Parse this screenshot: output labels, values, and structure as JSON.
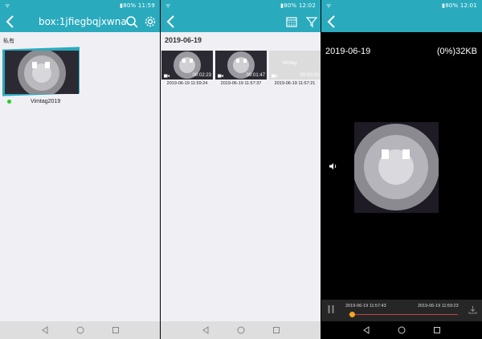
{
  "panel1": {
    "status": {
      "signal": "ᯤ",
      "battery": "▮80%",
      "time": "11:59"
    },
    "title": "box:1jfiegbqjxwna",
    "section_label": "私有",
    "device": {
      "name": "Vimtag2019",
      "online": true
    }
  },
  "panel2": {
    "status": {
      "signal": "ᯤ",
      "battery": "▮80%",
      "time": "12:02"
    },
    "date_header": "2019-06-19",
    "clips": [
      {
        "duration": "00:02:23",
        "timestamp": "2019-06-19 11:59:24"
      },
      {
        "duration": "00:01:47",
        "timestamp": "2019-06-19 11:57:37"
      },
      {
        "duration": "00:00:00",
        "timestamp": "2019-06-19 11:57:21",
        "brand": "Vimtag"
      }
    ]
  },
  "panel3": {
    "status": {
      "signal": "ᯤ",
      "battery": "▮80%",
      "time": "12:01"
    },
    "date": "2019-06-19",
    "size": "(0%)32KB",
    "start_time": "2019-06-19 11:57:43",
    "end_time": "2019-06-19 11:59:23",
    "progress": 0.03
  },
  "colors": {
    "accent": "#2aaabd",
    "online": "#20d020",
    "progress": "#f5a623"
  }
}
